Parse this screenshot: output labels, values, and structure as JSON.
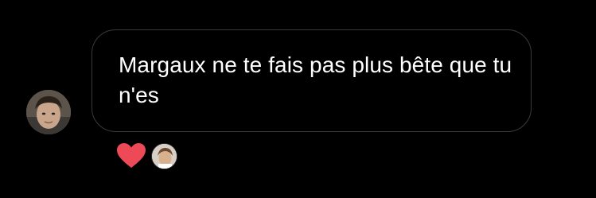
{
  "message": {
    "text": "Margaux ne te fais pas plus bête que tu n'es",
    "sender_avatar_icon": "user-avatar-photo"
  },
  "reactions": {
    "emoji_icon": "red-heart-icon",
    "heart_color": "#ed4956",
    "reactor_avatar_icon": "reactor-avatar-photo"
  },
  "colors": {
    "background": "#000000",
    "bubble_border": "#3a3a3c",
    "text": "#ffffff"
  }
}
